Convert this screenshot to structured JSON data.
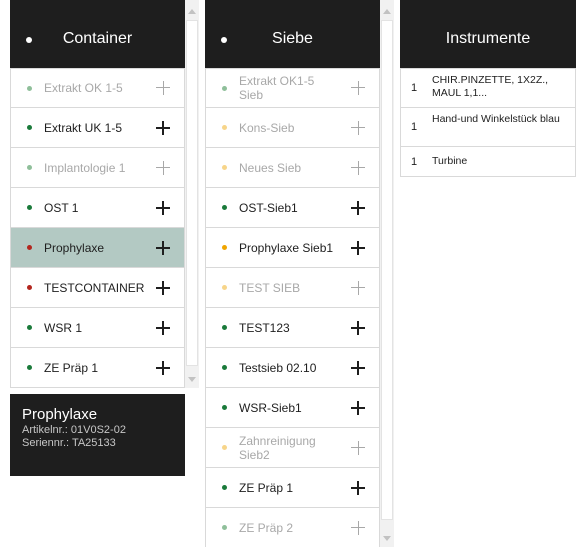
{
  "container_panel": {
    "title": "Container",
    "items": [
      {
        "label": "Extrakt OK 1-5",
        "color": "#8fbf9a",
        "faded": true,
        "selected": false
      },
      {
        "label": "Extrakt UK 1-5",
        "color": "#1a7a3a",
        "faded": false,
        "selected": false
      },
      {
        "label": "Implantologie 1",
        "color": "#8fbf9a",
        "faded": true,
        "selected": false
      },
      {
        "label": "OST 1",
        "color": "#1a7a3a",
        "faded": false,
        "selected": false
      },
      {
        "label": "Prophylaxe",
        "color": "#b3261e",
        "faded": false,
        "selected": true
      },
      {
        "label": "TESTCONTAINER",
        "color": "#b3261e",
        "faded": false,
        "selected": false
      },
      {
        "label": "WSR 1",
        "color": "#1a7a3a",
        "faded": false,
        "selected": false
      },
      {
        "label": "ZE Präp 1",
        "color": "#1a7a3a",
        "faded": false,
        "selected": false
      }
    ]
  },
  "detail": {
    "name": "Prophylaxe",
    "artikel": "Artikelnr.: 01V0S2-02",
    "serien": "Seriennr.: TA25133"
  },
  "siebe_panel": {
    "title": "Siebe",
    "items": [
      {
        "label": "Extrakt OK1-5 Sieb",
        "color": "#8fbf9a",
        "faded": true
      },
      {
        "label": "Kons-Sieb",
        "color": "#f7d58a",
        "faded": true
      },
      {
        "label": "Neues Sieb",
        "color": "#f7d58a",
        "faded": true
      },
      {
        "label": "OST-Sieb1",
        "color": "#1a7a3a",
        "faded": false
      },
      {
        "label": "Prophylaxe Sieb1",
        "color": "#f0a500",
        "faded": false
      },
      {
        "label": "TEST SIEB",
        "color": "#f7d58a",
        "faded": true
      },
      {
        "label": "TEST123",
        "color": "#1a7a3a",
        "faded": false
      },
      {
        "label": "Testsieb 02.10",
        "color": "#1a7a3a",
        "faded": false
      },
      {
        "label": "WSR-Sieb1",
        "color": "#1a7a3a",
        "faded": false
      },
      {
        "label": "Zahnreinigung Sieb2",
        "color": "#f7d58a",
        "faded": true
      },
      {
        "label": "ZE Präp 1",
        "color": "#1a7a3a",
        "faded": false
      },
      {
        "label": "ZE Präp 2",
        "color": "#8fbf9a",
        "faded": true
      }
    ]
  },
  "instrumente_panel": {
    "title": "Instrumente",
    "items": [
      {
        "qty": "1",
        "name": "CHIR.PINZETTE, 1X2Z., MAUL 1,1..."
      },
      {
        "qty": "1",
        "name": "Hand-und Winkelstück blau"
      },
      {
        "qty": "1",
        "name": "Turbine"
      }
    ]
  }
}
